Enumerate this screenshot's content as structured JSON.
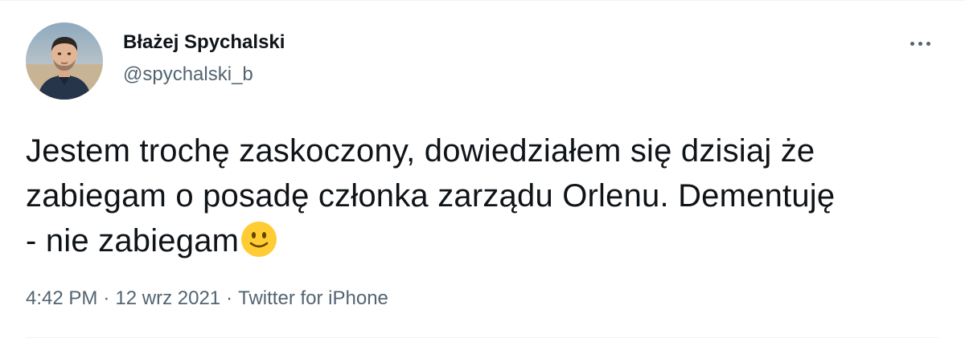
{
  "author": {
    "display_name": "Błażej Spychalski",
    "handle": "@spychalski_b",
    "avatar_icon": "profile-photo"
  },
  "tweet": {
    "text_lines": [
      "Jestem trochę zaskoczony, dowiedziałem się dzisiaj że",
      "zabiegam o posadę członka zarządu Orlenu. Dementuję",
      "- nie zabiegam"
    ],
    "emoji": "slightly-smiling-face-emoji"
  },
  "meta": {
    "time": "4:42 PM",
    "separator": "·",
    "date": "12 wrz 2021",
    "source": "Twitter for iPhone"
  },
  "menu": {
    "icon": "more-horizontal-icon"
  },
  "colors": {
    "text_primary": "#0f1419",
    "text_secondary": "#536471",
    "divider": "#eff3f4",
    "emoji_face": "#ffcc33"
  }
}
